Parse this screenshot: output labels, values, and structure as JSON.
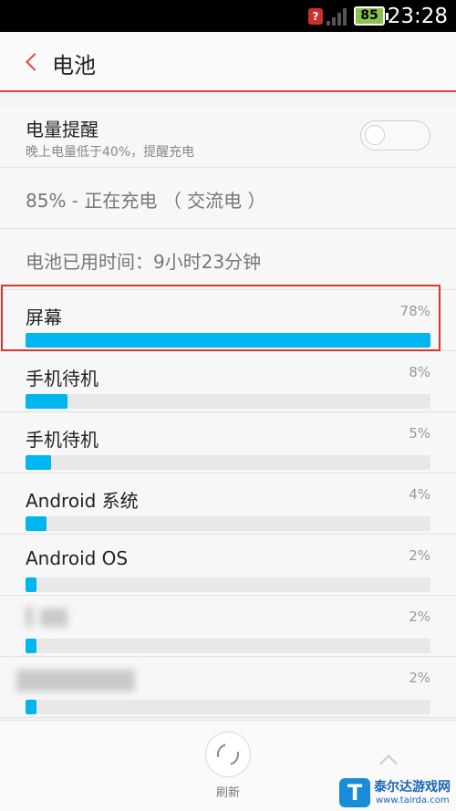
{
  "status_bar": {
    "battery": "85",
    "time": "23:28",
    "warning_icon": "question-badge-icon"
  },
  "header": {
    "back_icon": "chevron-left-icon",
    "title": "电池"
  },
  "reminder": {
    "title": "电量提醒",
    "subtitle": "晚上电量低于40%，提醒充电",
    "toggle_on": false
  },
  "charging_status": "85% - 正在充电 （ 交流电 ）",
  "usage_time": "电池已用时间：9小时23分钟",
  "usage_items": [
    {
      "name": "屏幕",
      "percent_label": "78%",
      "percent": 78
    },
    {
      "name": "手机待机",
      "percent_label": "8%",
      "percent": 8
    },
    {
      "name": "手机待机",
      "percent_label": "5%",
      "percent": 5
    },
    {
      "name": "Android 系统",
      "percent_label": "4%",
      "percent": 4
    },
    {
      "name": "Android OS",
      "percent_label": "2%",
      "percent": 2
    },
    {
      "name": "",
      "percent_label": "2%",
      "percent": 2
    },
    {
      "name": "",
      "percent_label": "2%",
      "percent": 2
    }
  ],
  "bottom": {
    "refresh_label": "刷新"
  },
  "watermark": {
    "name": "泰尔达游戏网",
    "url": "www.tairda.com",
    "logo_letter": "T"
  },
  "colors": {
    "accent": "#e8453c",
    "bar": "#00b6f0",
    "track": "#e8e8e8"
  }
}
